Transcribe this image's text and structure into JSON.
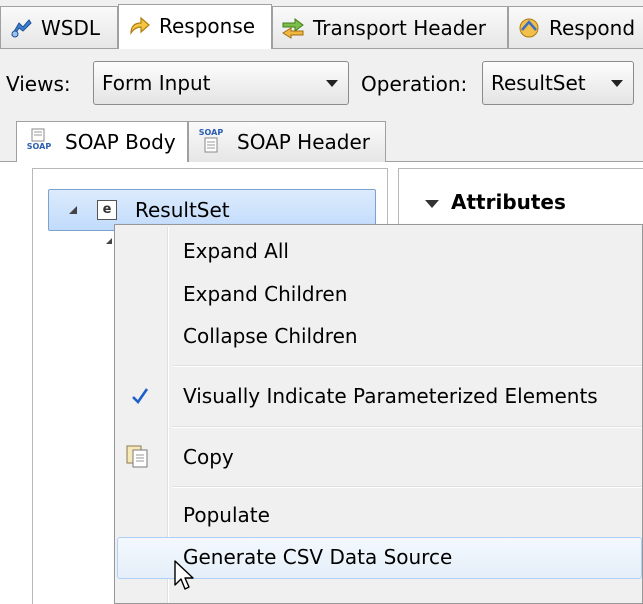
{
  "editor_tabs": [
    {
      "label": "WSDL",
      "icon": "wsdl-icon"
    },
    {
      "label": "Response",
      "icon": "response-icon"
    },
    {
      "label": "Transport Header",
      "icon": "transport-header-icon"
    },
    {
      "label": "Respond",
      "icon": "respond-icon"
    }
  ],
  "toolbar": {
    "views_label": "Views:",
    "views_value": "Form Input",
    "operation_label": "Operation:",
    "operation_value": "ResultSet"
  },
  "sub_tabs": [
    {
      "label": "SOAP Body",
      "icon_text": "SOAP"
    },
    {
      "label": "SOAP Header",
      "icon_text": "SOAP"
    }
  ],
  "tree": {
    "root_label": "ResultSet",
    "root_badge": "e"
  },
  "attributes": {
    "title": "Attributes"
  },
  "context_menu": {
    "items": [
      {
        "label": "Expand All"
      },
      {
        "label": "Expand Children"
      },
      {
        "label": "Collapse Children"
      },
      {
        "label": "Visually Indicate Parameterized Elements",
        "checked": true
      },
      {
        "label": "Copy"
      },
      {
        "label": "Populate"
      },
      {
        "label": "Generate CSV Data Source",
        "hover": true
      }
    ]
  },
  "colors": {
    "selection_fill": "#c1dbfc",
    "selection_border": "#7da2ce",
    "menu_bg": "#f0f0f0",
    "check_color": "#1e5fc8"
  }
}
